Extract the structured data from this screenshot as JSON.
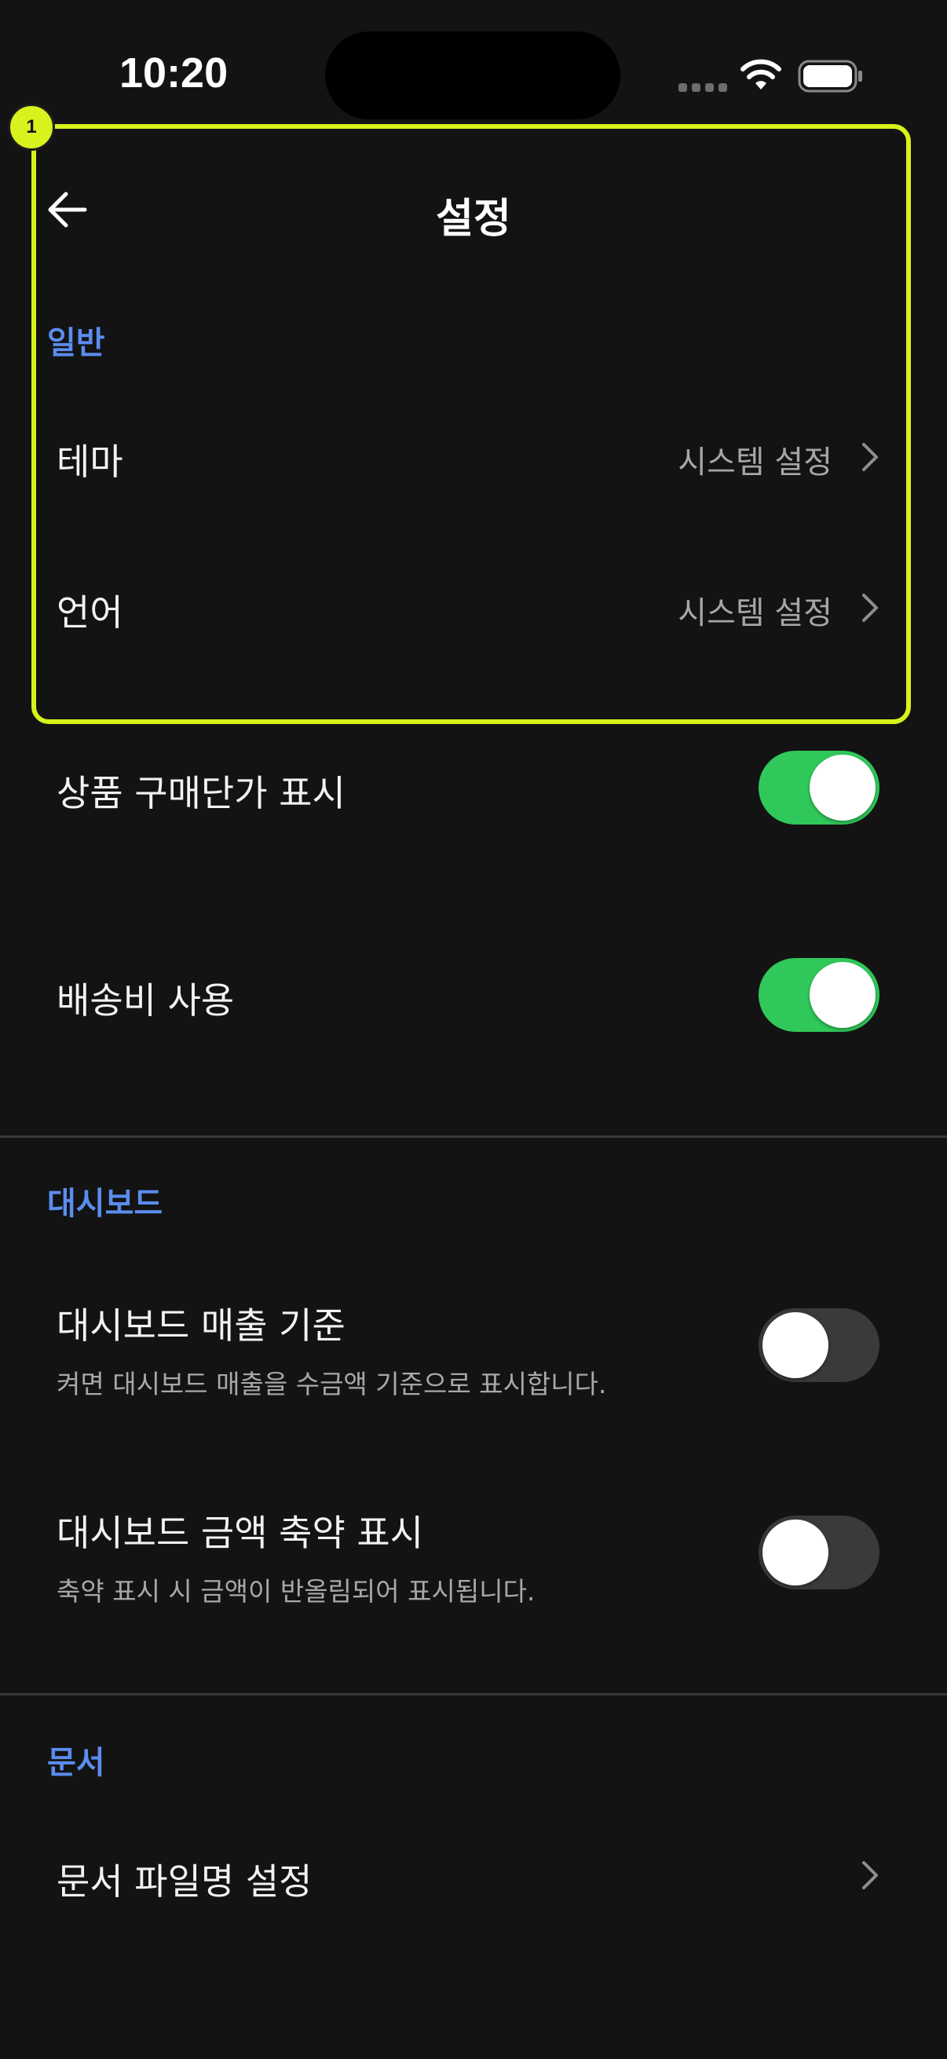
{
  "status_bar": {
    "time": "10:20"
  },
  "annotation": {
    "badge": "1",
    "color": "#d7f21c"
  },
  "header": {
    "title": "설정",
    "back_icon": "arrow-left-icon"
  },
  "sections": {
    "general": {
      "label": "일반",
      "theme": {
        "label": "테마",
        "value": "시스템 설정"
      },
      "language": {
        "label": "언어",
        "value": "시스템 설정"
      },
      "purchase_price": {
        "label": "상품 구매단가 표시",
        "enabled": true
      },
      "shipping_fee": {
        "label": "배송비 사용",
        "enabled": true
      }
    },
    "dashboard": {
      "label": "대시보드",
      "sales_basis": {
        "label": "대시보드 매출 기준",
        "description": "켜면 대시보드 매출을 수금액 기준으로 표시합니다.",
        "enabled": false
      },
      "abbreviate_amount": {
        "label": "대시보드 금액 축약 표시",
        "description": "축약 표시 시 금액이 반올림되어 표시됩니다.",
        "enabled": false
      }
    },
    "documents": {
      "label": "문서",
      "filename": {
        "label": "문서 파일명 설정"
      }
    }
  },
  "colors": {
    "accent": "#5b8def",
    "toggle_on": "#30c85a",
    "toggle_off": "#3a3a3c",
    "background": "#131313"
  }
}
